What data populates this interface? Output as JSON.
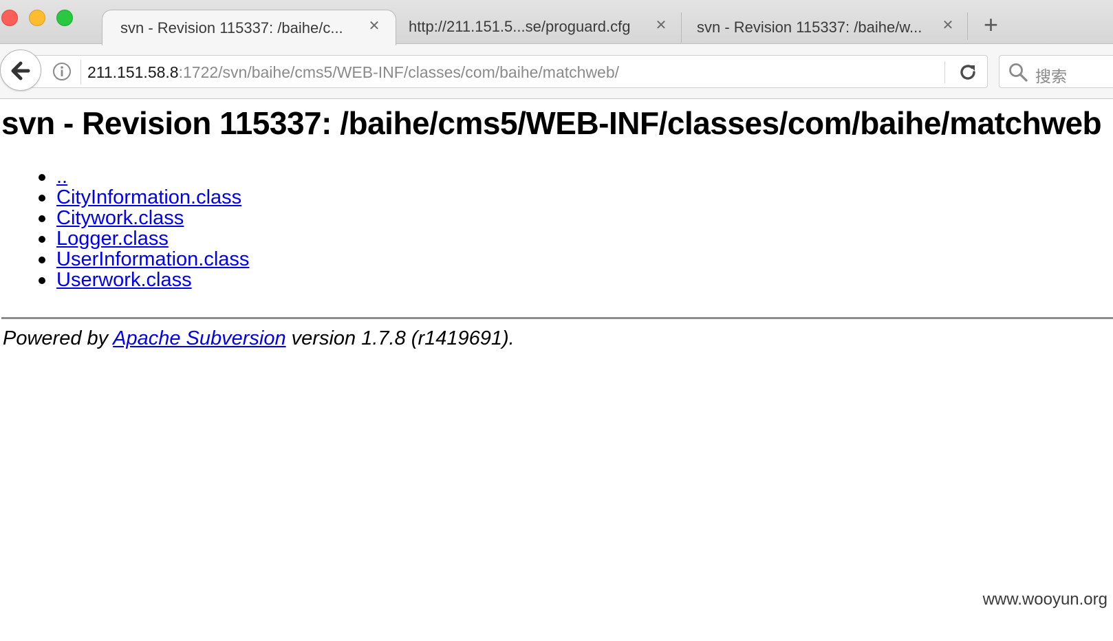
{
  "tabs": [
    {
      "title": "svn - Revision 115337: /baihe/c...",
      "active": true
    },
    {
      "title": "http://211.151.5...se/proguard.cfg",
      "active": false
    },
    {
      "title": "svn - Revision 115337: /baihe/w...",
      "active": false
    }
  ],
  "tab_close_glyph": "✕",
  "new_tab_glyph": "+",
  "address": {
    "host": "211.151.58.8",
    "rest": ":1722/svn/baihe/cms5/WEB-INF/classes/com/baihe/matchweb/"
  },
  "search": {
    "placeholder": "搜索"
  },
  "page": {
    "title": "svn - Revision 115337: /baihe/cms5/WEB-INF/classes/com/baihe/matchweb",
    "entries": [
      "..",
      "CityInformation.class",
      "Citywork.class",
      "Logger.class",
      "UserInformation.class",
      "Userwork.class"
    ],
    "footer": {
      "prefix": "Powered by ",
      "link": "Apache Subversion",
      "suffix": " version 1.7.8 (r1419691)."
    }
  },
  "watermark": "www.wooyun.org",
  "colors": {
    "link": "#0000ee",
    "close": "#fc5f57",
    "minimize": "#fdbc2e",
    "maximize": "#29c840"
  }
}
